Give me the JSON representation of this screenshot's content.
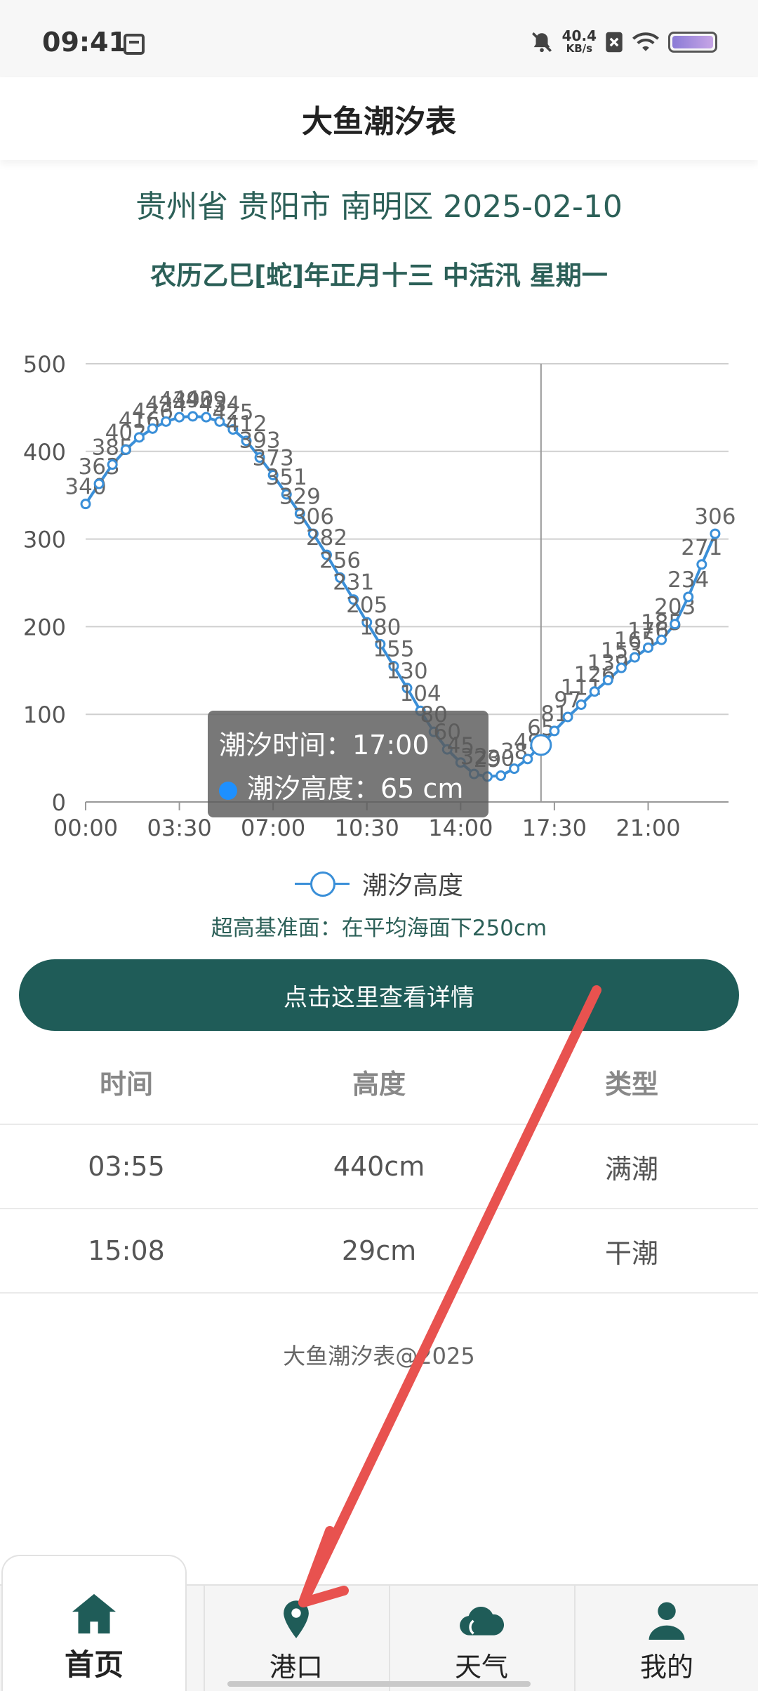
{
  "status_bar": {
    "time": "09:41",
    "speed_value": "40.4",
    "speed_unit": "KB/s"
  },
  "header": {
    "title": "大鱼潮汐表"
  },
  "location": "贵州省 贵阳市 南明区  2025-02-10",
  "lunar_line": "农历乙巳[蛇]年正月十三  中活汛  星期一",
  "chart_data": {
    "type": "line",
    "title": "",
    "xlabel": "",
    "ylabel": "",
    "ylim": [
      0,
      500
    ],
    "yticks": [
      0,
      100,
      200,
      300,
      400,
      500
    ],
    "xlim": [
      0,
      24
    ],
    "xticks": [
      "00:00",
      "03:30",
      "07:00",
      "10:30",
      "14:00",
      "17:30",
      "21:00"
    ],
    "legend": "bottom-center",
    "grid": true,
    "series": [
      {
        "name": "潮汐高度",
        "color": "#3a8fd8",
        "x": [
          0,
          0.5,
          1,
          1.5,
          2,
          2.5,
          3,
          3.5,
          4,
          4.5,
          5,
          5.5,
          6,
          6.5,
          7,
          7.5,
          8,
          8.5,
          9,
          9.5,
          10,
          10.5,
          11,
          11.5,
          12,
          12.5,
          13,
          13.5,
          14,
          14.5,
          15,
          15.5,
          16,
          16.5,
          17,
          17.5,
          18,
          18.5,
          19,
          19.5,
          20,
          20.5,
          21,
          21.5,
          22,
          22.5,
          23,
          23.5
        ],
        "values": [
          340,
          363,
          385,
          402,
          416,
          426,
          434,
          439,
          440,
          439,
          434,
          425,
          412,
          393,
          373,
          351,
          329,
          306,
          282,
          256,
          231,
          205,
          180,
          155,
          130,
          104,
          80,
          60,
          45,
          32,
          29,
          30,
          38,
          49,
          65,
          81,
          97,
          111,
          126,
          139,
          153,
          165,
          176,
          185,
          203,
          234,
          271,
          306
        ]
      }
    ],
    "tooltip": {
      "time_label": "潮汐时间：17:00",
      "height_label": "潮汐高度：65 cm"
    },
    "highlight_x": 17
  },
  "datum_note": "超高基准面：在平均海面下250cm",
  "detail_button": "点击这里查看详情",
  "table": {
    "headers": [
      "时间",
      "高度",
      "类型"
    ],
    "rows": [
      [
        "03:55",
        "440cm",
        "满潮"
      ],
      [
        "15:08",
        "29cm",
        "干潮"
      ]
    ]
  },
  "footer": "大鱼潮汐表@2025",
  "nav": [
    {
      "label": "首页",
      "icon": "home-icon",
      "active": true
    },
    {
      "label": "港口",
      "icon": "location-pin-icon",
      "active": false
    },
    {
      "label": "天气",
      "icon": "cloud-icon",
      "active": false
    },
    {
      "label": "我的",
      "icon": "user-icon",
      "active": false
    }
  ],
  "colors": {
    "brand": "#1f5c58",
    "text_accent": "#2c6058",
    "series": "#3a8fd8",
    "annotation_arrow": "#e8524f"
  }
}
